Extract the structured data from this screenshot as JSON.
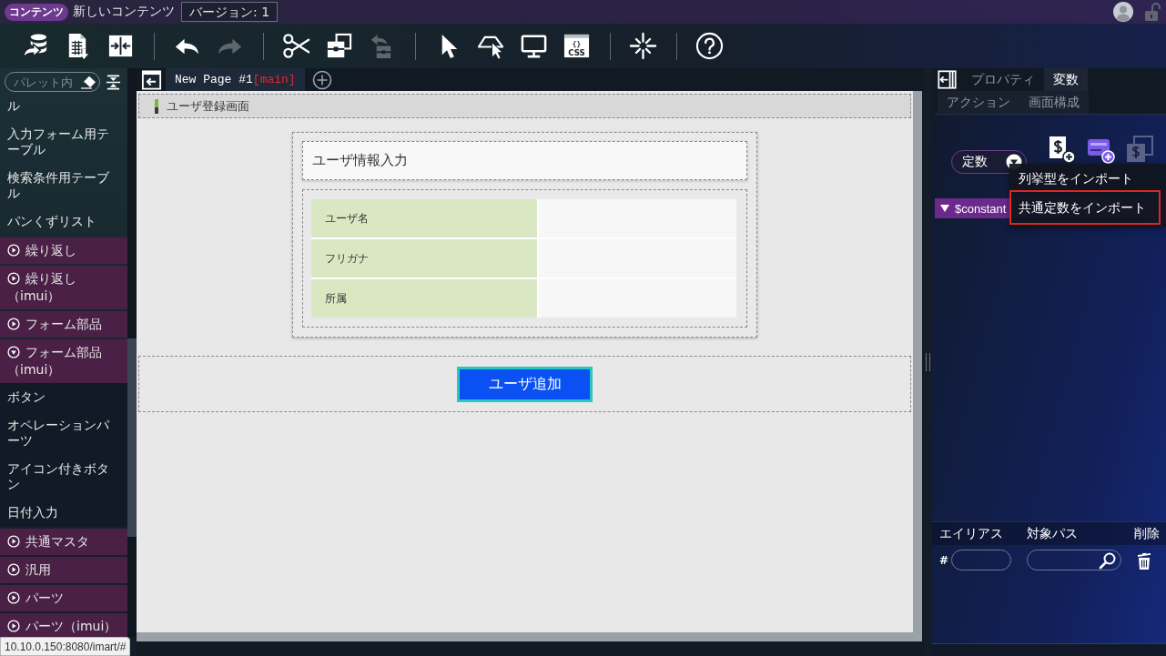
{
  "title_bar": {
    "badge": "コンテンツ",
    "content_name": "新しいコンテンツ",
    "version": "バージョン: 1"
  },
  "toolbar": {
    "groups": [
      [
        {
          "disabled": false
        },
        {
          "disabled": false
        },
        {
          "disabled": false
        }
      ],
      [
        {
          "disabled": false
        },
        {
          "disabled": true
        }
      ],
      [
        {
          "disabled": false
        },
        {
          "disabled": false
        },
        {
          "disabled": true
        }
      ],
      [
        {
          "disabled": false
        },
        {
          "disabled": false
        },
        {
          "disabled": false
        },
        {
          "disabled": false,
          "icon_text": [
            "{}",
            "CSS"
          ]
        }
      ],
      [
        {
          "disabled": false
        }
      ],
      [
        {
          "disabled": false
        }
      ]
    ]
  },
  "palette": {
    "search": {
      "placeholder": "パレット内"
    },
    "items": [
      {
        "kind": "item",
        "label": "ル"
      },
      {
        "kind": "item",
        "label": "入力フォーム用テーブル"
      },
      {
        "kind": "item",
        "label": "検索条件用テーブル"
      },
      {
        "kind": "item",
        "label": "パンくずリスト"
      },
      {
        "kind": "category",
        "label": "繰り返し",
        "expanded": false
      },
      {
        "kind": "category",
        "label": "繰り返し（imui）",
        "expanded": false
      },
      {
        "kind": "category",
        "label": "フォーム部品",
        "expanded": false
      },
      {
        "kind": "category",
        "label": "フォーム部品（imui）",
        "expanded": true,
        "children": [
          {
            "kind": "item",
            "label": "ボタン"
          },
          {
            "kind": "item",
            "label": "オペレーションパーツ"
          },
          {
            "kind": "item",
            "label": "アイコン付きボタン"
          },
          {
            "kind": "item",
            "label": "日付入力"
          }
        ]
      },
      {
        "kind": "category",
        "label": "共通マスタ",
        "expanded": false
      },
      {
        "kind": "category",
        "label": "汎用",
        "expanded": false
      },
      {
        "kind": "category",
        "label": "パーツ",
        "expanded": false
      },
      {
        "kind": "category",
        "label": "パーツ（imui）",
        "expanded": false
      }
    ]
  },
  "editor": {
    "tabs": [
      {
        "label": "New Page #1",
        "branch": "[main]",
        "selected": true
      }
    ],
    "canvas": {
      "header": "ユーザ登録画面",
      "form_title": "ユーザ情報入力",
      "fields": [
        {
          "label": "ユーザ名"
        },
        {
          "label": "フリガナ"
        },
        {
          "label": "所属"
        }
      ],
      "button": "ユーザ追加"
    }
  },
  "right_panel": {
    "tab_rows": [
      [
        {
          "label": "プロパティ",
          "selected": false
        },
        {
          "label": "変数",
          "selected": true
        }
      ],
      [
        {
          "label": "アクション",
          "selected": false
        },
        {
          "label": "画面構成",
          "selected": false
        }
      ]
    ],
    "type_select": {
      "value": "定数"
    },
    "icon_buttons": [
      {
        "disabled": false
      },
      {
        "disabled": false
      },
      {
        "disabled": true
      }
    ],
    "menu": [
      {
        "label": "列挙型をインポート",
        "highlighted": false
      },
      {
        "label": "共通定数をインポート",
        "highlighted": true
      }
    ],
    "variables": [
      {
        "name": "$constant",
        "expanded": true
      }
    ],
    "alias_table": {
      "columns": [
        "エイリアス",
        "対象パス",
        "削除"
      ],
      "rows": [
        {
          "prefix": "#"
        }
      ]
    }
  },
  "status_url": "10.10.0.150:8080/imart/#"
}
